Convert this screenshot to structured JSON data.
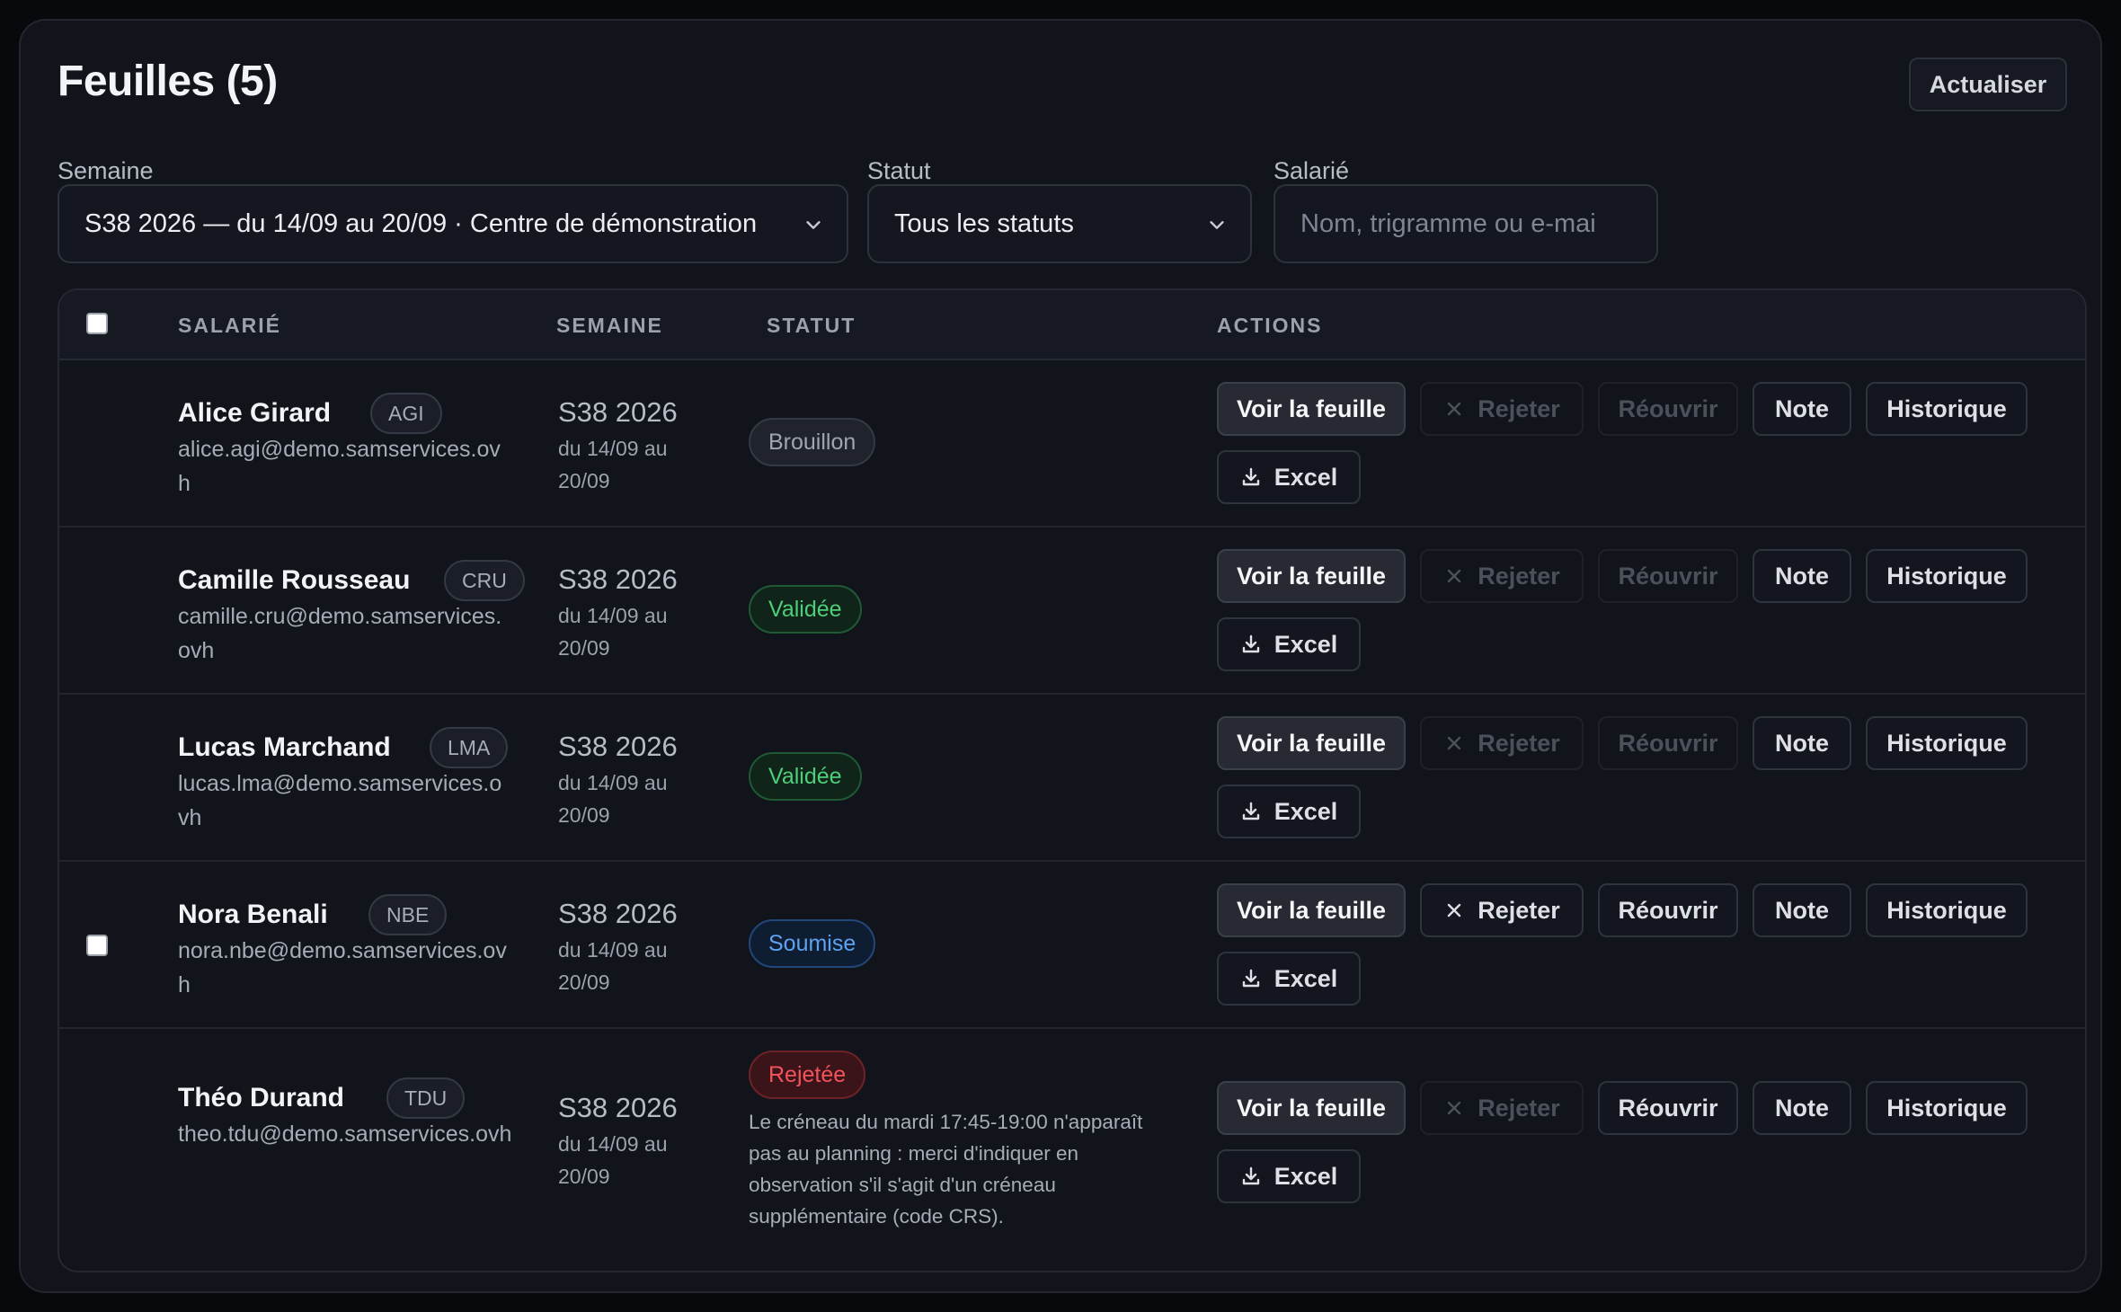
{
  "header": {
    "title": "Feuilles (5)",
    "refresh_label": "Actualiser"
  },
  "filters": {
    "week": {
      "label": "Semaine",
      "value": "S38 2026 — du 14/09 au 20/09 · Centre de démonstration"
    },
    "status": {
      "label": "Statut",
      "value": "Tous les statuts"
    },
    "employee": {
      "label": "Salarié",
      "placeholder": "Nom, trigramme ou e-mai"
    }
  },
  "table": {
    "columns": {
      "employee": "SALARIÉ",
      "week": "SEMAINE",
      "status": "STATUT",
      "actions": "ACTIONS"
    },
    "actions": {
      "view": "Voir la feuille",
      "reject": "Rejeter",
      "reopen": "Réouvrir",
      "note": "Note",
      "history": "Historique",
      "excel": "Excel"
    },
    "rows": [
      {
        "name": "Alice Girard",
        "trigram": "AGI",
        "email": "alice.agi@demo.samservices.ovh",
        "week": "S38 2026",
        "range": "du 14/09 au 20/09",
        "status": "Brouillon",
        "status_kind": "draft",
        "reject_enabled": false,
        "reopen_enabled": false,
        "selectable": false,
        "note": ""
      },
      {
        "name": "Camille Rousseau",
        "trigram": "CRU",
        "email": "camille.cru@demo.samservices.ovh",
        "week": "S38 2026",
        "range": "du 14/09 au 20/09",
        "status": "Validée",
        "status_kind": "valid",
        "reject_enabled": false,
        "reopen_enabled": false,
        "selectable": false,
        "note": ""
      },
      {
        "name": "Lucas Marchand",
        "trigram": "LMA",
        "email": "lucas.lma@demo.samservices.ovh",
        "week": "S38 2026",
        "range": "du 14/09 au 20/09",
        "status": "Validée",
        "status_kind": "valid",
        "reject_enabled": false,
        "reopen_enabled": false,
        "selectable": false,
        "note": ""
      },
      {
        "name": "Nora Benali",
        "trigram": "NBE",
        "email": "nora.nbe@demo.samservices.ovh",
        "week": "S38 2026",
        "range": "du 14/09 au 20/09",
        "status": "Soumise",
        "status_kind": "sub",
        "reject_enabled": true,
        "reopen_enabled": true,
        "selectable": true,
        "note": ""
      },
      {
        "name": "Théo Durand",
        "trigram": "TDU",
        "email": "theo.tdu@demo.samservices.ovh",
        "week": "S38 2026",
        "range": "du 14/09 au 20/09",
        "status": "Rejetée",
        "status_kind": "rej",
        "reject_enabled": false,
        "reopen_enabled": true,
        "selectable": false,
        "note": "Le créneau du mardi 17:45-19:00 n'apparaît pas au planning : merci d'indiquer en observation s'il s'agit d'un créneau supplémentaire (code CRS)."
      }
    ]
  }
}
